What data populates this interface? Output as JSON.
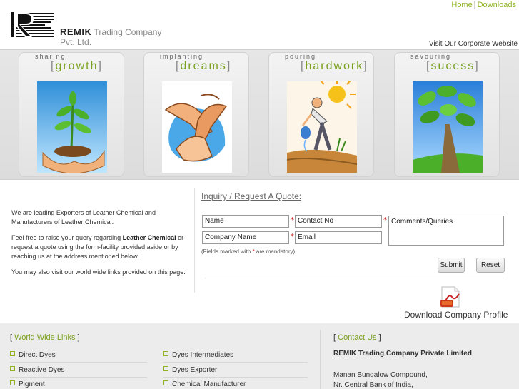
{
  "header": {
    "logo_name": "REMIK",
    "logo_rest": "Trading Company Pvt. Ltd.",
    "nav": [
      {
        "label": "Home"
      },
      {
        "label": "Downloads"
      }
    ],
    "corporate_link": "Visit Our Corporate Website"
  },
  "cards": [
    {
      "pre": "sharing",
      "word": "growth",
      "image": "plant-in-hands"
    },
    {
      "pre": "implanting",
      "word": "dreams",
      "image": "clasped-hands"
    },
    {
      "pre": "pouring",
      "word": "hardwork",
      "image": "farmer-watering"
    },
    {
      "pre": "savouring",
      "word": "sucess",
      "image": "tree"
    }
  ],
  "intro": {
    "p1": "We are leading Exporters of Leather Chemical and Manufacturers of Leather Chemical.",
    "p2_a": "Feel free to raise your query regarding ",
    "p2_b": "Leather Chemical",
    "p2_c": " or request a quote using the form-facility provided aside or by reaching us at the address mentioned below.",
    "p3": "You may also visit our world wide links provided on this page."
  },
  "form": {
    "title": "Inquiry / Request A Quote:",
    "name": "Name",
    "contact": "Contact No",
    "company": "Company Name",
    "email": "Email",
    "comments": "Comments/Queries",
    "req_mark": "*",
    "mandatory_a": "(Fields marked with ",
    "mandatory_b": " are mandatory)",
    "submit": "Submit",
    "reset": "Reset"
  },
  "download": {
    "label": "Download Company Profile",
    "icon": "pdf-icon"
  },
  "footer": {
    "links_title": "World Wide Links",
    "bracket_open": "[",
    "bracket_close": "]",
    "col1": [
      "Direct Dyes",
      "Reactive Dyes",
      "Pigment"
    ],
    "col2": [
      "Dyes Intermediates",
      "Dyes Exporter",
      "Chemical Manufacturer"
    ],
    "contact_title": "Contact Us",
    "company": "REMIK Trading Company Private Limited",
    "address": [
      "Manan Bungalow Compound,",
      "Nr. Central Bank of India,"
    ]
  },
  "colors": {
    "accent": "#7aa020",
    "required": "#cc2222"
  }
}
